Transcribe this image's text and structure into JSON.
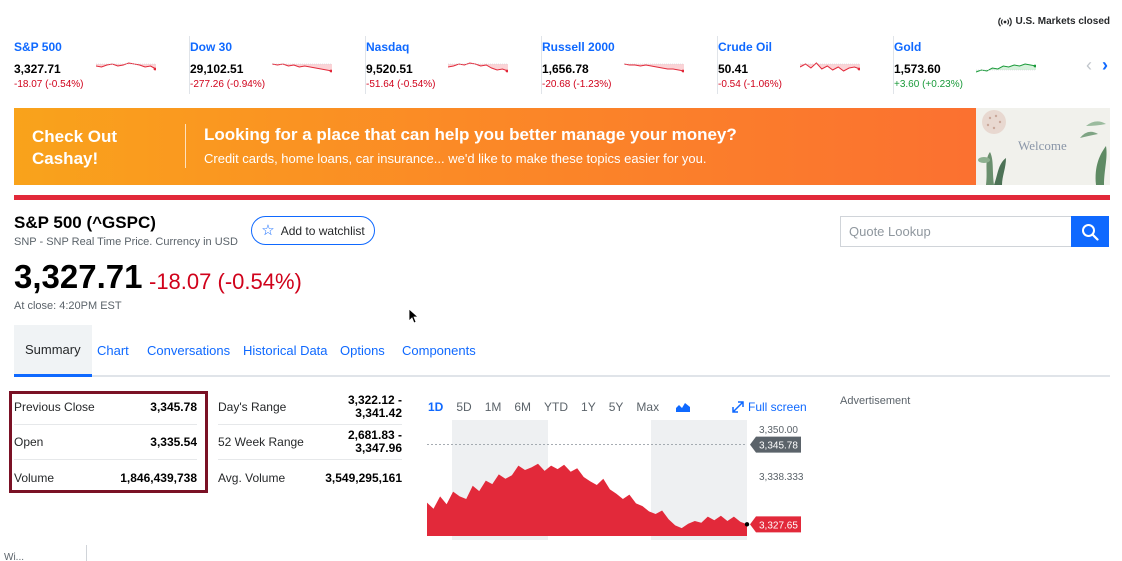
{
  "market_status": "U.S. Markets closed",
  "tickers": [
    {
      "name": "S&P 500",
      "price": "3,327.71",
      "change": "-18.07 (-0.54%)",
      "direction": "neg"
    },
    {
      "name": "Dow 30",
      "price": "29,102.51",
      "change": "-277.26 (-0.94%)",
      "direction": "neg"
    },
    {
      "name": "Nasdaq",
      "price": "9,520.51",
      "change": "-51.64 (-0.54%)",
      "direction": "neg"
    },
    {
      "name": "Russell 2000",
      "price": "1,656.78",
      "change": "-20.68 (-1.23%)",
      "direction": "neg"
    },
    {
      "name": "Crude Oil",
      "price": "50.41",
      "change": "-0.54 (-1.06%)",
      "direction": "neg"
    },
    {
      "name": "Gold",
      "price": "1,573.60",
      "change": "+3.60 (+0.23%)",
      "direction": "pos"
    }
  ],
  "banner": {
    "left_text": "Check Out Cashay!",
    "title": "Looking for a place that can help you better manage your money?",
    "subtitle": "Credit cards, home loans, car insurance... we'd like to make these topics easier for you.",
    "image_text": "Welcome"
  },
  "quote": {
    "title": "S&P 500 (^GSPC)",
    "subtitle": "SNP - SNP Real Time Price. Currency in USD",
    "watchlist_label": "Add to watchlist",
    "price": "3,327.71",
    "change": "-18.07 (-0.54%)",
    "at_close": "At close: 4:20PM EST"
  },
  "search": {
    "placeholder": "Quote Lookup"
  },
  "tabs": [
    "Summary",
    "Chart",
    "Conversations",
    "Historical Data",
    "Options",
    "Components"
  ],
  "active_tab": "Summary",
  "stats_left": [
    {
      "label": "Previous Close",
      "value": "3,345.78"
    },
    {
      "label": "Open",
      "value": "3,335.54"
    },
    {
      "label": "Volume",
      "value": "1,846,439,738"
    }
  ],
  "stats_right": [
    {
      "label": "Day's Range",
      "value_line1": "3,322.12 -",
      "value_line2": "3,341.42"
    },
    {
      "label": "52 Week Range",
      "value_line1": "2,681.83 -",
      "value_line2": "3,347.96"
    },
    {
      "label": "Avg. Volume",
      "value_line1": "3,549,295,161",
      "value_line2": ""
    }
  ],
  "chart_controls": {
    "ranges": [
      "1D",
      "5D",
      "1M",
      "6M",
      "YTD",
      "1Y",
      "5Y",
      "Max"
    ],
    "active_range": "1D",
    "full_screen_label": "Full screen"
  },
  "chart_data": {
    "type": "area",
    "y_ticks": [
      "3,350.00",
      "3,338.333"
    ],
    "ylim": [
      3325,
      3350
    ],
    "reference_label": "3,345.78",
    "reference_value": 3345.78,
    "last_label": "3,327.65",
    "last_value": 3327.65,
    "color": "#e2293a",
    "values": [
      3332.6,
      3331.2,
      3334.0,
      3332.2,
      3335.1,
      3334.0,
      3333.4,
      3336.4,
      3335.2,
      3337.6,
      3336.8,
      3339.0,
      3338.0,
      3338.8,
      3341.0,
      3340.0,
      3340.6,
      3341.4,
      3339.8,
      3341.0,
      3340.2,
      3341.2,
      3339.6,
      3340.4,
      3338.4,
      3337.4,
      3336.6,
      3338.0,
      3335.6,
      3334.6,
      3333.4,
      3334.4,
      3332.4,
      3331.8,
      3330.6,
      3330.0,
      3330.8,
      3328.8,
      3327.4,
      3326.8,
      3327.8,
      3328.4,
      3328.0,
      3329.4,
      3328.6,
      3329.6,
      3328.4,
      3329.4,
      3328.2,
      3327.65
    ]
  },
  "advertisement_label": "Advertisement",
  "bottom_fragment": "Wi..."
}
